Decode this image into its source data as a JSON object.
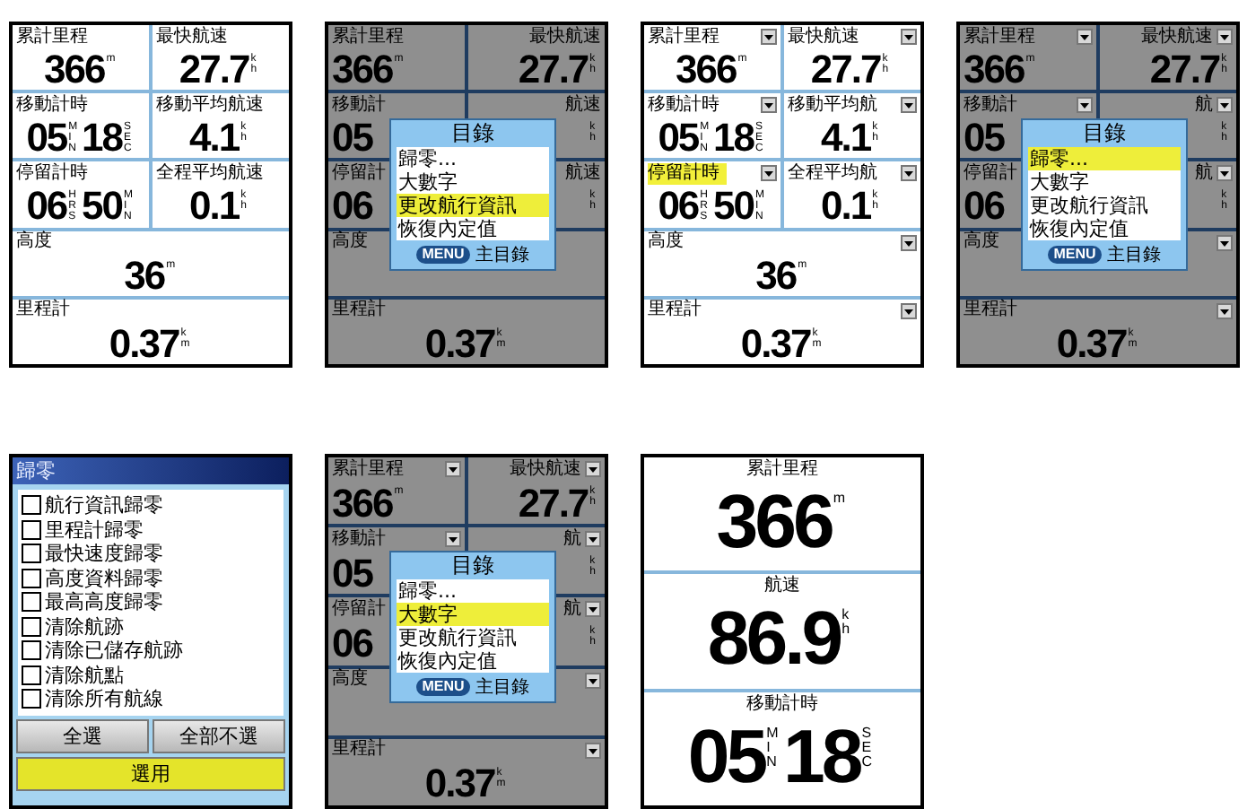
{
  "screens": [
    {
      "kind": "dashboard",
      "dimmed": false,
      "fields": [
        {
          "label": "累計里程",
          "parts": [
            {
              "num": "366",
              "unit": "m"
            }
          ],
          "wide": false,
          "selected": false
        },
        {
          "label": "最快航速",
          "parts": [
            {
              "num": "27.7",
              "unit": "kh"
            }
          ],
          "wide": false,
          "selected": false
        },
        {
          "label": "移動計時",
          "parts": [
            {
              "num": "05",
              "unit": "MIN"
            },
            {
              "num": "18",
              "unit": "SEC"
            }
          ],
          "wide": false,
          "selected": false
        },
        {
          "label": "移動平均航速",
          "parts": [
            {
              "num": "4.1",
              "unit": "kh"
            }
          ],
          "wide": false,
          "selected": false
        },
        {
          "label": "停留計時",
          "parts": [
            {
              "num": "06",
              "unit": "HRS"
            },
            {
              "num": "50",
              "unit": "MIN"
            }
          ],
          "wide": false,
          "selected": false
        },
        {
          "label": "全程平均航速",
          "parts": [
            {
              "num": "0.1",
              "unit": "kh"
            }
          ],
          "wide": false,
          "selected": false
        },
        {
          "label": "高度",
          "parts": [
            {
              "num": "36",
              "unit": "m"
            }
          ],
          "wide": true,
          "selected": false
        },
        {
          "label": "里程計",
          "parts": [
            {
              "num": "0.37",
              "unit": "km"
            }
          ],
          "wide": true,
          "selected": false
        }
      ]
    },
    {
      "kind": "dashboard",
      "dimmed": true,
      "fields": [
        {
          "label": "累計里程",
          "parts": [
            {
              "num": "366",
              "unit": "m"
            }
          ],
          "wide": false
        },
        {
          "label": "最快航速",
          "parts": [
            {
              "num": "27.7",
              "unit": "kh"
            }
          ],
          "wide": false
        },
        {
          "label": "移動計",
          "parts": [
            {
              "num": "05"
            }
          ],
          "wide": false
        },
        {
          "label": "航速",
          "parts": [
            {
              "unit": "kh"
            }
          ],
          "wide": false
        },
        {
          "label": "停留計",
          "parts": [
            {
              "num": "06"
            }
          ],
          "wide": false
        },
        {
          "label": "航速",
          "parts": [
            {
              "unit": "kh"
            }
          ],
          "wide": false
        },
        {
          "label": "高度",
          "wide": true
        },
        {
          "label": "里程計",
          "parts": [
            {
              "num": "0.37",
              "unit": "km"
            }
          ],
          "wide": true
        }
      ],
      "menu": {
        "title": "目錄",
        "items": [
          {
            "label": "歸零...",
            "selected": false
          },
          {
            "label": "大數字",
            "selected": false
          },
          {
            "label": "更改航行資訊",
            "selected": true
          },
          {
            "label": "恢復內定值",
            "selected": false
          }
        ],
        "key": "MENU",
        "hint": "主目錄"
      }
    },
    {
      "kind": "dashboard",
      "dimmed": false,
      "fields": [
        {
          "label": "累計里程",
          "parts": [
            {
              "num": "366",
              "unit": "m"
            }
          ],
          "wide": false,
          "selected": false,
          "dropdown": true
        },
        {
          "label": "最快航速",
          "parts": [
            {
              "num": "27.7",
              "unit": "kh"
            }
          ],
          "wide": false,
          "selected": false,
          "dropdown": true
        },
        {
          "label": "移動計時",
          "parts": [
            {
              "num": "05",
              "unit": "MIN"
            },
            {
              "num": "18",
              "unit": "SEC"
            }
          ],
          "wide": false,
          "selected": false,
          "dropdown": true
        },
        {
          "label": "移動平均航",
          "parts": [
            {
              "num": "4.1",
              "unit": "kh"
            }
          ],
          "wide": false,
          "selected": false,
          "dropdown": true
        },
        {
          "label": "停留計時",
          "parts": [
            {
              "num": "06",
              "unit": "HRS"
            },
            {
              "num": "50",
              "unit": "MIN"
            }
          ],
          "wide": false,
          "selected": true,
          "dropdown": true
        },
        {
          "label": "全程平均航",
          "parts": [
            {
              "num": "0.1",
              "unit": "kh"
            }
          ],
          "wide": false,
          "selected": false,
          "dropdown": true
        },
        {
          "label": "高度",
          "parts": [
            {
              "num": "36",
              "unit": "m"
            }
          ],
          "wide": true,
          "selected": false,
          "dropdown": true
        },
        {
          "label": "里程計",
          "parts": [
            {
              "num": "0.37",
              "unit": "km"
            }
          ],
          "wide": true,
          "selected": false,
          "dropdown": true
        }
      ]
    },
    {
      "kind": "dashboard",
      "dimmed": true,
      "fields": [
        {
          "label": "累計里程",
          "parts": [
            {
              "num": "366",
              "unit": "m"
            }
          ],
          "wide": false,
          "dropdown": true
        },
        {
          "label": "最快航速",
          "parts": [
            {
              "num": "27.7",
              "unit": "kh"
            }
          ],
          "wide": false,
          "dropdown": true
        },
        {
          "label": "移動計",
          "parts": [
            {
              "num": "05"
            }
          ],
          "wide": false,
          "dropdown": true
        },
        {
          "label": "航",
          "parts": [
            {
              "unit": "kh"
            }
          ],
          "wide": false,
          "dropdown": true
        },
        {
          "label": "停留計",
          "parts": [
            {
              "num": "06"
            }
          ],
          "wide": false,
          "dropdown": false
        },
        {
          "label": "航",
          "parts": [
            {
              "unit": "kh"
            }
          ],
          "wide": false,
          "dropdown": true
        },
        {
          "label": "高度",
          "wide": true,
          "dropdown": true
        },
        {
          "label": "里程計",
          "parts": [
            {
              "num": "0.37",
              "unit": "km"
            }
          ],
          "wide": true,
          "dropdown": true
        }
      ],
      "menu": {
        "title": "目錄",
        "items": [
          {
            "label": "歸零...",
            "selected": true
          },
          {
            "label": "大數字",
            "selected": false
          },
          {
            "label": "更改航行資訊",
            "selected": false
          },
          {
            "label": "恢復內定值",
            "selected": false
          }
        ],
        "key": "MENU",
        "hint": "主目錄"
      }
    },
    {
      "kind": "reset",
      "title": "歸零",
      "options": [
        {
          "label": "航行資訊歸零",
          "checked": false
        },
        {
          "label": "里程計歸零",
          "checked": false
        },
        {
          "label": "最快速度歸零",
          "checked": false
        },
        {
          "label": "高度資料歸零",
          "checked": false
        },
        {
          "label": "最高高度歸零",
          "checked": false
        },
        {
          "label": "清除航跡",
          "checked": false
        },
        {
          "label": "清除已儲存航跡",
          "checked": false
        },
        {
          "label": "清除航點",
          "checked": false
        },
        {
          "label": "清除所有航線",
          "checked": false
        }
      ],
      "buttons": [
        {
          "label": "全選",
          "selected": false
        },
        {
          "label": "全部不選",
          "selected": false
        },
        {
          "label": "選用",
          "selected": true
        }
      ]
    },
    {
      "kind": "dashboard",
      "dimmed": true,
      "fields": [
        {
          "label": "累計里程",
          "parts": [
            {
              "num": "366",
              "unit": "m"
            }
          ],
          "wide": false,
          "dropdown": true
        },
        {
          "label": "最快航速",
          "parts": [
            {
              "num": "27.7",
              "unit": "kh"
            }
          ],
          "wide": false,
          "dropdown": true
        },
        {
          "label": "移動計",
          "parts": [
            {
              "num": "05"
            }
          ],
          "wide": false,
          "dropdown": true
        },
        {
          "label": "航",
          "parts": [
            {
              "unit": "kh"
            }
          ],
          "wide": false,
          "dropdown": true
        },
        {
          "label": "停留計",
          "parts": [
            {
              "num": "06"
            }
          ],
          "wide": false,
          "dropdown": false
        },
        {
          "label": "航",
          "parts": [
            {
              "unit": "kh"
            }
          ],
          "wide": false,
          "dropdown": true
        },
        {
          "label": "高度",
          "wide": true,
          "dropdown": true
        },
        {
          "label": "里程計",
          "parts": [
            {
              "num": "0.37",
              "unit": "km"
            }
          ],
          "wide": true,
          "dropdown": true
        }
      ],
      "menu": {
        "title": "目錄",
        "items": [
          {
            "label": "歸零...",
            "selected": false
          },
          {
            "label": "大數字",
            "selected": true
          },
          {
            "label": "更改航行資訊",
            "selected": false
          },
          {
            "label": "恢復內定值",
            "selected": false
          }
        ],
        "key": "MENU",
        "hint": "主目錄"
      }
    },
    {
      "kind": "big_numbers",
      "fields": [
        {
          "label": "累計里程",
          "parts": [
            {
              "num": "366",
              "unit": "m"
            }
          ]
        },
        {
          "label": "航速",
          "parts": [
            {
              "num": "86.9",
              "unit": "kh"
            }
          ]
        },
        {
          "label": "移動計時",
          "parts": [
            {
              "num": "05",
              "unit": "MIN"
            },
            {
              "num": "18",
              "unit": "SEC"
            }
          ]
        }
      ]
    }
  ]
}
